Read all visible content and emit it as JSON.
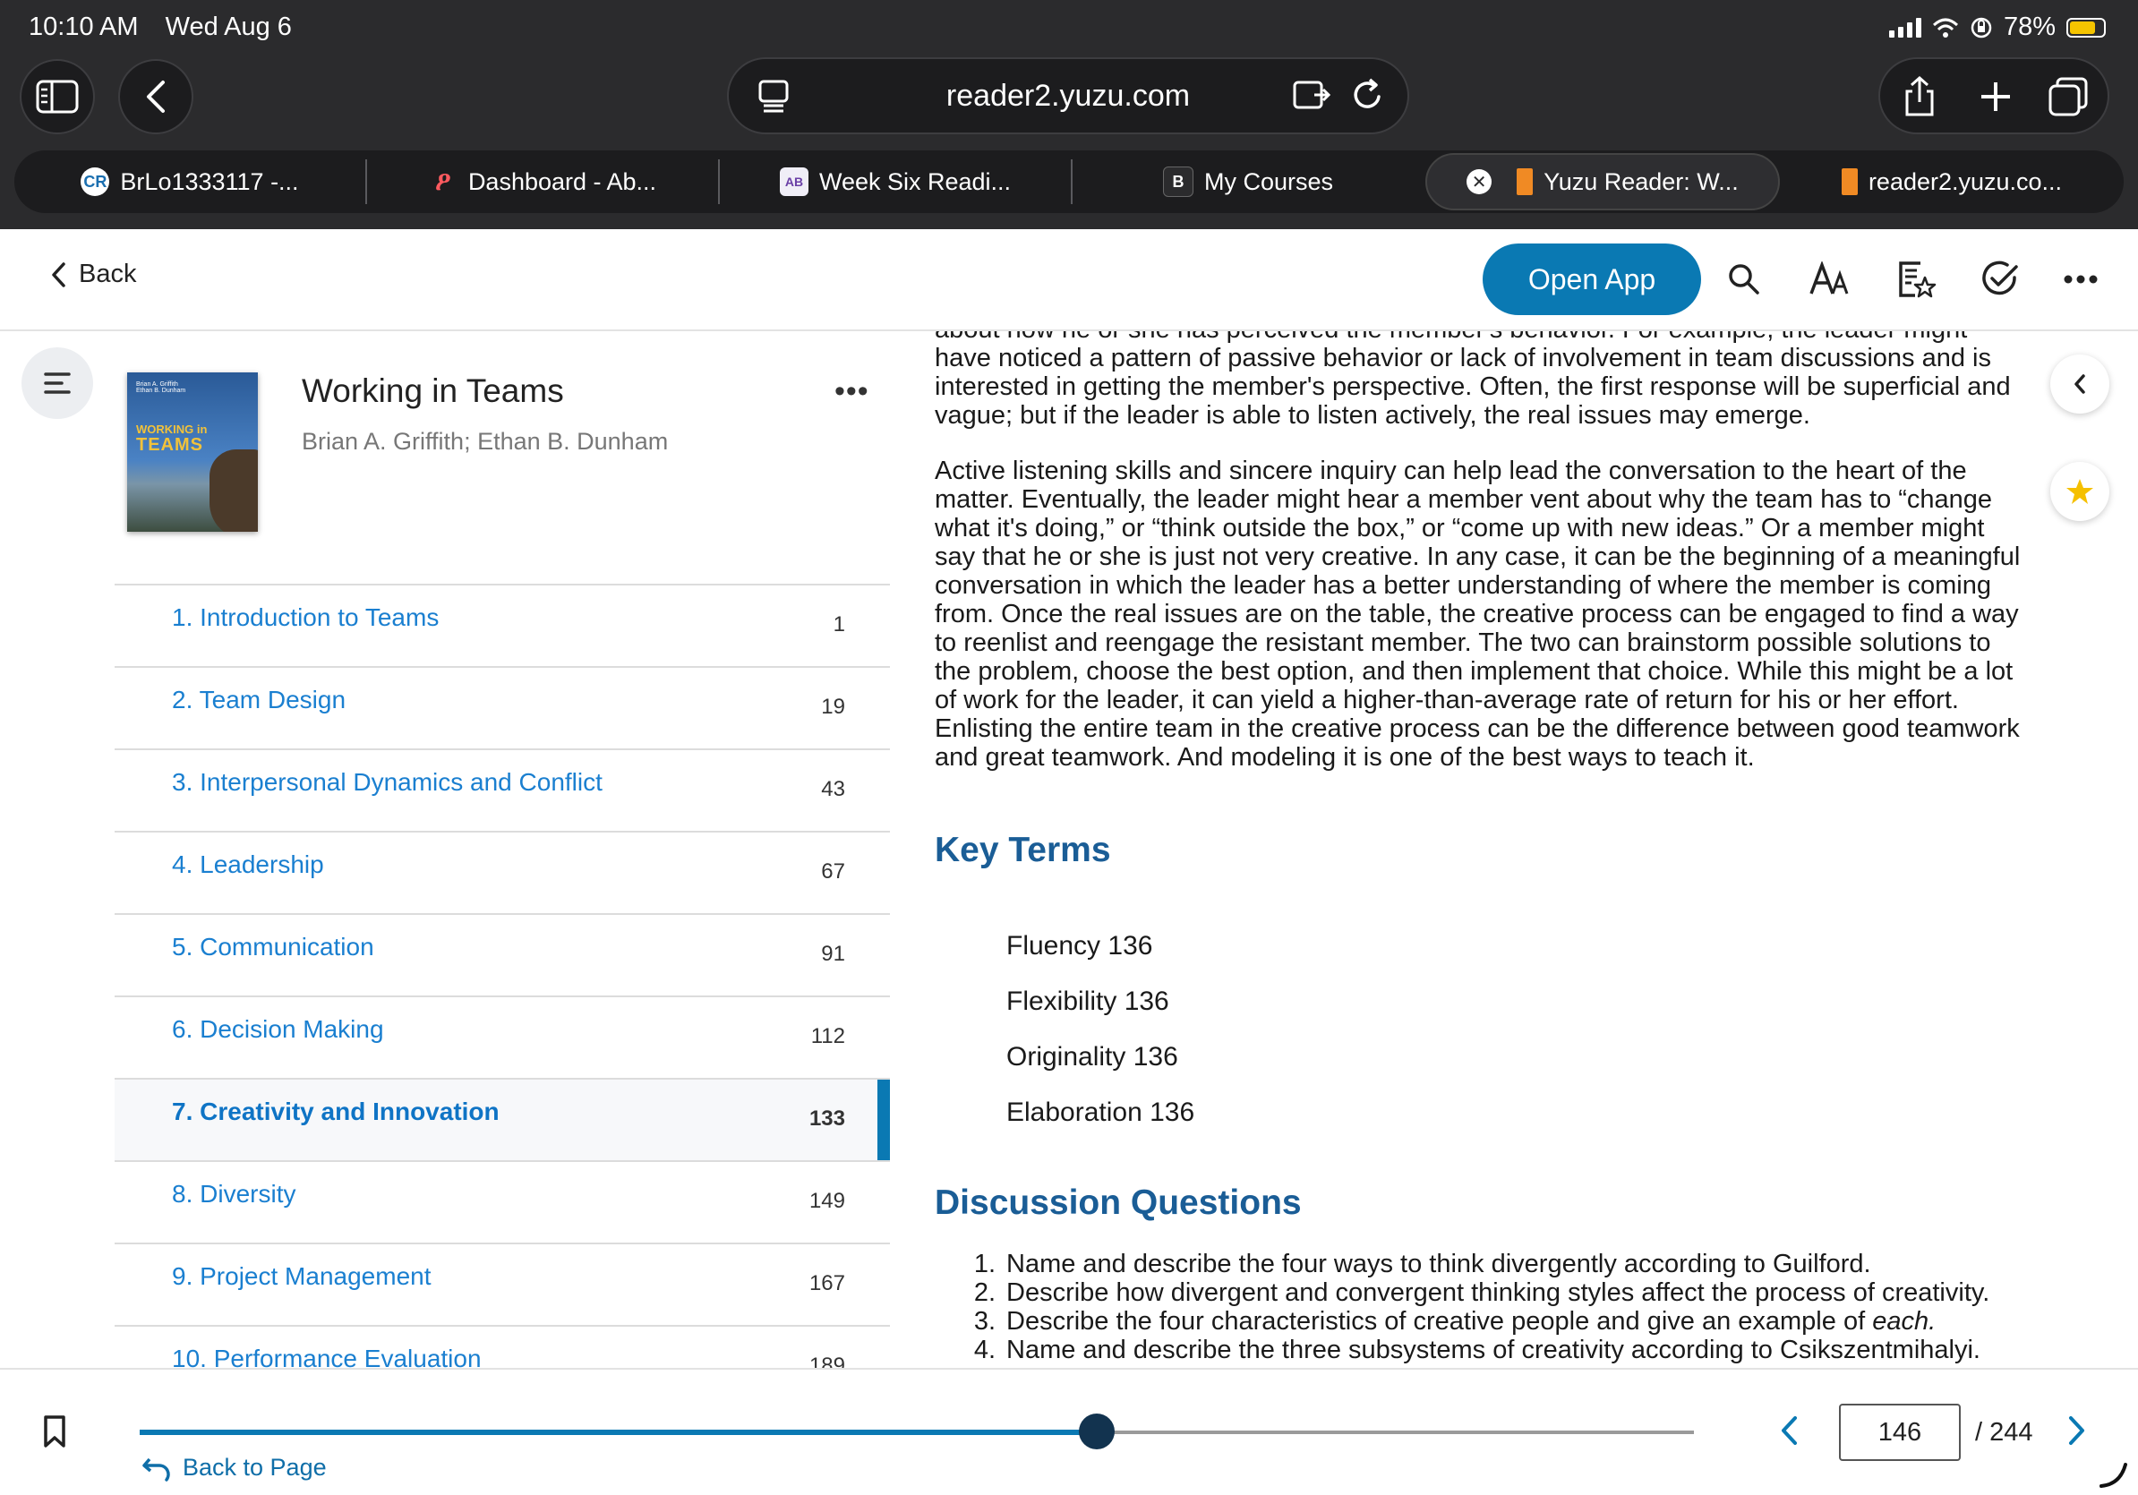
{
  "status_bar": {
    "time": "10:10 AM",
    "date": "Wed Aug 6",
    "battery": "78%"
  },
  "browser": {
    "url": "reader2.yuzu.com",
    "tabs": [
      {
        "label": "BrLo1333117 -..."
      },
      {
        "label": "Dashboard - Ab..."
      },
      {
        "label": "Week Six Readi..."
      },
      {
        "label": "My Courses",
        "favicon_text": "B"
      },
      {
        "label": "Yuzu Reader: W..."
      },
      {
        "label": "reader2.yuzu.co..."
      }
    ]
  },
  "header": {
    "back_label": "Back",
    "open_app_label": "Open App"
  },
  "book": {
    "title": "Working in Teams",
    "authors": "Brian A. Griffith; Ethan B. Dunham",
    "more": "•••",
    "cover": {
      "title_small": "WORKING in",
      "title_big": "TEAMS"
    }
  },
  "toc": [
    {
      "label": "1. Introduction to Teams",
      "page": "1"
    },
    {
      "label": "2. Team Design",
      "page": "19"
    },
    {
      "label": "3. Interpersonal Dynamics and Conflict",
      "page": "43"
    },
    {
      "label": "4. Leadership",
      "page": "67"
    },
    {
      "label": "5. Communication",
      "page": "91"
    },
    {
      "label": "6. Decision Making",
      "page": "112"
    },
    {
      "label": "7. Creativity and Innovation",
      "page": "133",
      "active": true
    },
    {
      "label": "8. Diversity",
      "page": "149"
    },
    {
      "label": "9. Project Management",
      "page": "167"
    },
    {
      "label": "10. Performance Evaluation",
      "page": "189"
    }
  ],
  "reader": {
    "para0_cut": "about how he or she has perceived the member's behavior. For example, the leader might",
    "para1": "have noticed a pattern of passive behavior or lack of involvement in team discussions and is interested in getting the member's perspective. Often, the first response will be superficial and vague; but if the leader is able to listen actively, the real issues may emerge.",
    "para2": "Active listening skills and sincere inquiry can help lead the conversation to the heart of the matter. Eventually, the leader might hear a member vent about why the team has to “change what it's doing,” or “think outside the box,” or “come up with new ideas.” Or a member might say that he or she is just not very creative. In any case, it can be the beginning of a meaningful conversation in which the leader has a better understanding of where the member is coming from. Once the real issues are on the table, the creative process can be engaged to find a way to reenlist and reengage the resistant member. The two can brainstorm possible solutions to the problem, choose the best option, and then implement that choice. While this might be a lot of work for the leader, it can yield a higher-than-average rate of return for his or her effort. Enlisting the entire team in the creative process can be the difference between good teamwork and great teamwork. And modeling it is one of the best ways to teach it.",
    "key_terms_heading": "Key Terms",
    "key_terms": [
      "Fluency 136",
      "Flexibility 136",
      "Originality 136",
      "Elaboration 136"
    ],
    "discussion_heading": "Discussion Questions",
    "questions": [
      {
        "num": "1.",
        "text": "Name and describe the four ways to think divergently according to Guilford."
      },
      {
        "num": "2.",
        "text": "Describe how divergent and convergent thinking styles affect the process of creativity."
      },
      {
        "num": "3.",
        "text": "Describe the four characteristics of creative people and give an example of",
        "em": "each."
      },
      {
        "num": "4.",
        "text": "Name and describe the three subsystems of creativity according to Csikszentmihalyi."
      }
    ]
  },
  "footer": {
    "back_to_page": "Back to Page",
    "current_page": "146",
    "total_pages": "/ 244",
    "progress": 0.616
  },
  "colors": {
    "accent": "#0a79b3",
    "link": "#1a7fd0",
    "heading": "#1a5d96",
    "chrome": "#2b2b2d",
    "star": "#f5c000"
  }
}
